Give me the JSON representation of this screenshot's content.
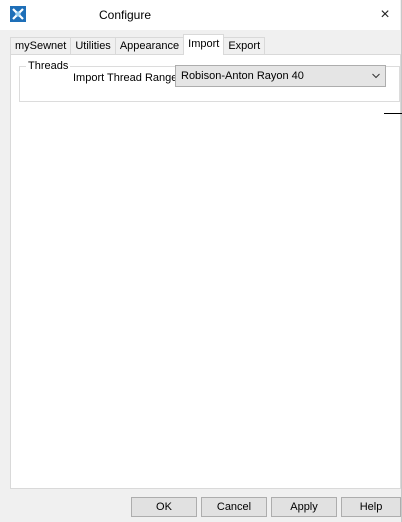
{
  "window": {
    "title": "Configure",
    "close_label": "×"
  },
  "icons": {
    "app": "app-logo-icon",
    "close": "close-icon",
    "dropdown": "chevron-down-icon"
  },
  "tabs": [
    {
      "label": "mySewnet"
    },
    {
      "label": "Utilities"
    },
    {
      "label": "Appearance"
    },
    {
      "label": "Import",
      "active": true
    },
    {
      "label": "Export"
    }
  ],
  "threads": {
    "group_title": "Threads",
    "import_range_label": "Import Thread Range",
    "import_range_value": "Robison-Anton Rayon 40"
  },
  "buttons": {
    "ok": "OK",
    "cancel": "Cancel",
    "apply": "Apply",
    "help": "Help"
  },
  "colors": {
    "logo": "#1e6fb8",
    "panel": "#ffffff",
    "window": "#f0f0f0"
  }
}
